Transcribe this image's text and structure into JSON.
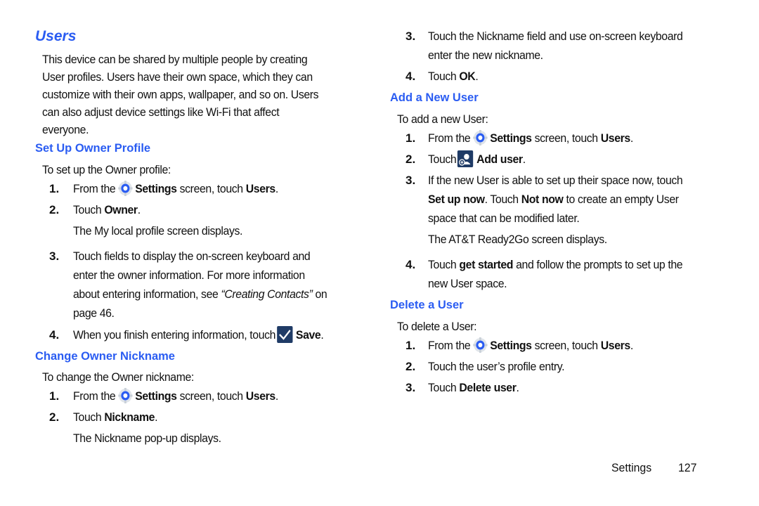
{
  "left": {
    "title": "Users",
    "intro": [
      "This device can be shared by multiple people by creating",
      "User profiles. Users have their own space, which they can",
      "customize with their own apps, wallpaper, and so on. Users",
      "can also adjust device settings like Wi-Fi that affect",
      "everyone."
    ],
    "setup": {
      "heading": "Set Up Owner Profile",
      "lead": "To set up the Owner profile:",
      "s1": {
        "n": "1.",
        "a": "From the",
        "b1": "Settings",
        "c": "screen, touch",
        "b2": "Users",
        "d": "."
      },
      "s2": {
        "n": "2.",
        "a": "Touch",
        "b": "Owner",
        "d": ".",
        "note": "The My local profile screen displays."
      },
      "s3": {
        "n": "3.",
        "l1": "Touch fields to display the on-screen keyboard and",
        "l2": "enter the owner information. For more information",
        "l3a": "about entering information, see",
        "l3i": "“Creating Contacts”",
        "l3b": "on",
        "l4": "page 46."
      },
      "s4": {
        "n": "4.",
        "a": "When you finish entering information, touch",
        "b": "Save",
        "d": "."
      }
    },
    "nickname": {
      "heading": "Change Owner Nickname",
      "lead": "To change the Owner nickname:",
      "s1": {
        "n": "1.",
        "a": "From the",
        "b1": "Settings",
        "c": "screen, touch",
        "b2": "Users",
        "d": "."
      },
      "s2": {
        "n": "2.",
        "a": "Touch",
        "b": "Nickname",
        "d": ".",
        "note": "The Nickname pop-up displays."
      }
    }
  },
  "right": {
    "nickname_cont": {
      "s3": {
        "n": "3.",
        "l1": "Touch the Nickname field and use on-screen keyboard",
        "l2": "enter the new nickname."
      },
      "s4": {
        "n": "4.",
        "a": "Touch",
        "b": "OK",
        "d": "."
      }
    },
    "add": {
      "heading": "Add a New User",
      "lead": "To add a new User:",
      "s1": {
        "n": "1.",
        "a": "From the",
        "b1": "Settings",
        "c": "screen, touch",
        "b2": "Users",
        "d": "."
      },
      "s2": {
        "n": "2.",
        "a": "Touch",
        "b": "Add user",
        "d": "."
      },
      "s3": {
        "n": "3.",
        "l1": "If the new User is able to set up their space now, touch",
        "b1": "Set up now",
        "m": ". Touch",
        "b2": "Not now",
        "e": "to create an empty User",
        "l3": "space that can be modified later.",
        "note": "The AT&T Ready2Go screen displays."
      },
      "s4": {
        "n": "4.",
        "a": "Touch",
        "b": "get started",
        "c": "and follow the prompts to set up the",
        "l2": "new User space."
      }
    },
    "del": {
      "heading": "Delete a User",
      "lead": "To delete a User:",
      "s1": {
        "n": "1.",
        "a": "From the",
        "b1": "Settings",
        "c": "screen, touch",
        "b2": "Users",
        "d": "."
      },
      "s2": {
        "n": "2.",
        "a": "Touch the user’s profile entry."
      },
      "s3": {
        "n": "3.",
        "a": "Touch",
        "b": "Delete user",
        "d": "."
      }
    }
  },
  "footer": {
    "section": "Settings",
    "page": "127"
  },
  "icons": {
    "settings": "settings-gear-icon",
    "save": "checkmark-save-icon",
    "add_user": "add-user-icon"
  },
  "colors": {
    "heading": "#2a5cf2",
    "icon_bg": "#1f3b66",
    "gear_blue": "#2a5cf2"
  }
}
